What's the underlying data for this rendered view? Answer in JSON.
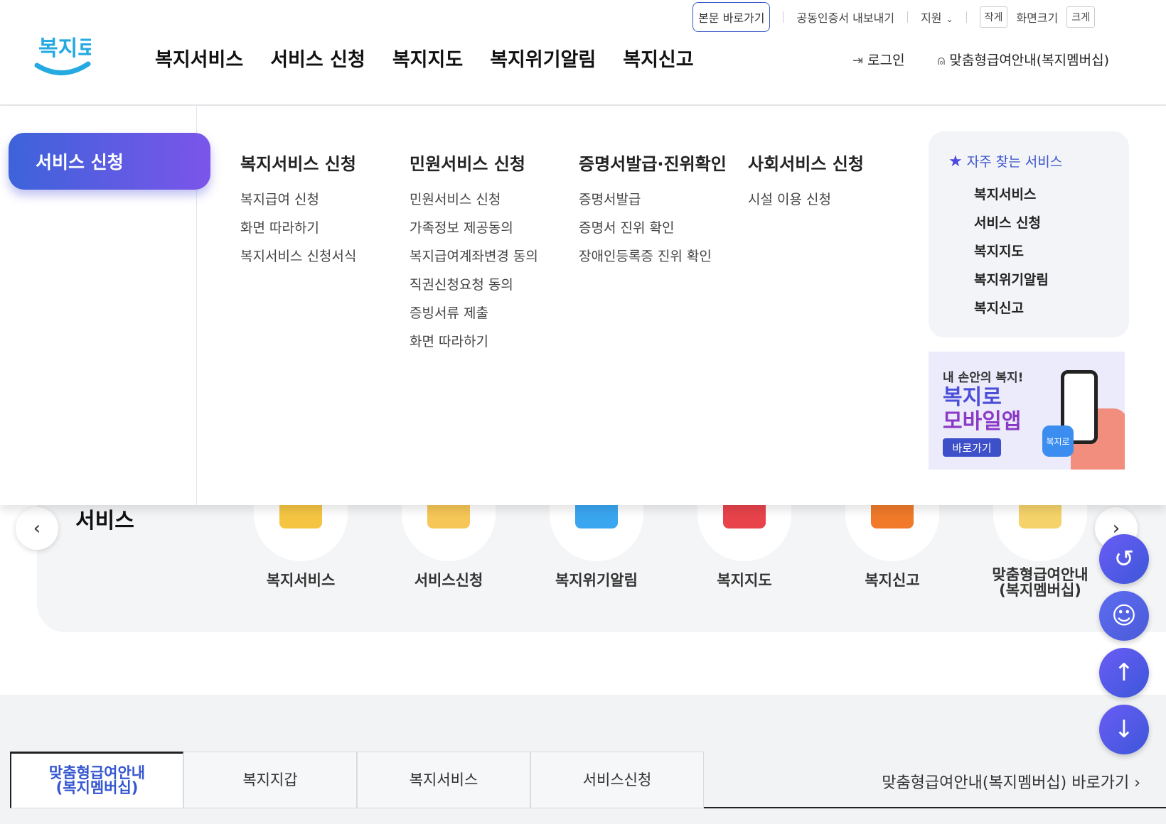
{
  "utility": {
    "skip": "본문 바로가기",
    "cert": "공동인증서 내보내기",
    "support": "지원",
    "small": "작게",
    "font_size": "화면크기",
    "large": "크게"
  },
  "logo_text": "복지로",
  "gnb": [
    "복지서비스",
    "서비스 신청",
    "복지지도",
    "복지위기알림",
    "복지신고"
  ],
  "header_right": {
    "login": "로그인",
    "membership": "맞춤형급여안내(복지멤버십)"
  },
  "mega": {
    "active": "서비스 신청",
    "columns": [
      {
        "title": "복지서비스 신청",
        "items": [
          "복지급여 신청",
          "화면 따라하기",
          "복지서비스 신청서식"
        ]
      },
      {
        "title": "민원서비스 신청",
        "items": [
          "민원서비스 신청",
          "가족정보 제공동의",
          "복지급여계좌변경 동의",
          "직권신청요청 동의",
          "증빙서류 제출",
          "화면 따라하기"
        ]
      },
      {
        "title": "증명서발급·진위확인",
        "items": [
          "증명서발급",
          "증명서 진위 확인",
          "장애인등록증 진위 확인"
        ]
      },
      {
        "title": "사회서비스 신청",
        "items": [
          "시설 이용 신청"
        ]
      }
    ],
    "favorites": {
      "title": "자주 찾는 서비스",
      "items": [
        "복지서비스",
        "서비스 신청",
        "복지지도",
        "복지위기알림",
        "복지신고"
      ]
    },
    "banner": {
      "line1": "내 손안의 복지!",
      "line2": "복지로",
      "line3": "모바일앱",
      "button": "바로가기",
      "app_icon": "복지로"
    }
  },
  "services": {
    "title": "서비스",
    "items": [
      {
        "label": "복지서비스",
        "color": "#f5c542"
      },
      {
        "label": "서비스신청",
        "color": "#f6c656"
      },
      {
        "label": "복지위기알림",
        "color": "#3aa6f0"
      },
      {
        "label": "복지지도",
        "color": "#e8434b"
      },
      {
        "label": "복지신고",
        "color": "#f07a2a"
      },
      {
        "label": "맞춤형급여안내\n(복지멤버십)",
        "color": "#f6d36a"
      }
    ]
  },
  "bottom_tabs": {
    "tabs": [
      "맞춤형급여안내\n(복지멤버십)",
      "복지지갑",
      "복지서비스",
      "서비스신청"
    ],
    "link": "맞춤형급여안내(복지멤버십) 바로가기 ›"
  },
  "colors": {
    "accent": "#3d57d9",
    "accent2": "#7b55ea"
  }
}
